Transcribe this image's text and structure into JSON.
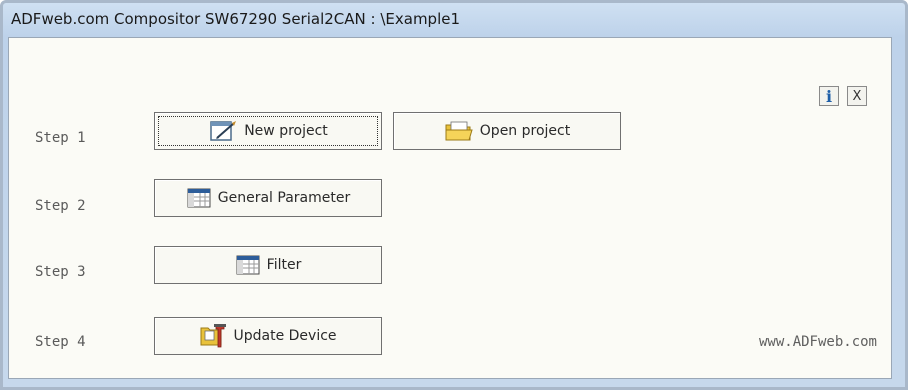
{
  "window": {
    "title": "ADFweb.com Compositor SW67290 Serial2CAN : \\Example1"
  },
  "steps": [
    {
      "label": "Step 1"
    },
    {
      "label": "Step 2"
    },
    {
      "label": "Step 3"
    },
    {
      "label": "Step 4"
    }
  ],
  "buttons": {
    "new_project": {
      "label": "New project",
      "icon": "new-project-icon"
    },
    "open_project": {
      "label": "Open project",
      "icon": "folder-open-icon"
    },
    "general_parameter": {
      "label": "General Parameter",
      "icon": "table-icon"
    },
    "filter": {
      "label": "Filter",
      "icon": "table-icon"
    },
    "update_device": {
      "label": "Update Device",
      "icon": "update-device-icon"
    }
  },
  "top_right": {
    "info": {
      "glyph": "i",
      "icon": "info-icon"
    },
    "close": {
      "glyph": "X",
      "icon": "close-icon"
    }
  },
  "footer": {
    "url": "www.ADFweb.com"
  },
  "colors": {
    "titlebar": "#c4d7ed",
    "client_background": "#fbfbf6",
    "info_blue": "#1f5fa8"
  }
}
